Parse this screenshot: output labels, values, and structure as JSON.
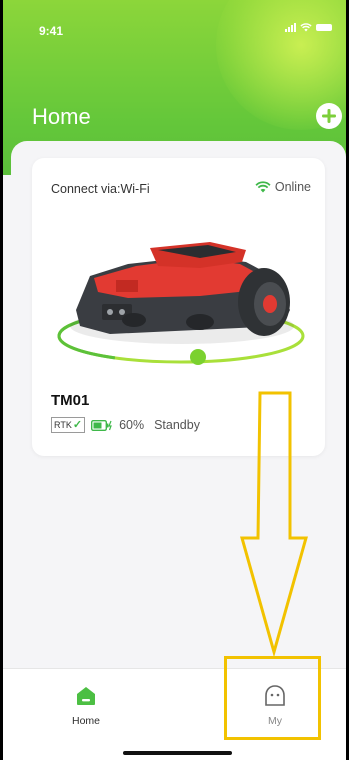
{
  "status_bar": {
    "time": "9:41"
  },
  "header": {
    "title": "Home"
  },
  "device_card": {
    "connection_label": "Connect via:Wi-Fi",
    "connection_status": "Online",
    "device_name": "TM01",
    "rtk_label": "RTK",
    "battery_percent": "60%",
    "state": "Standby"
  },
  "tabbar": {
    "tabs": [
      {
        "label": "Home",
        "icon": "home-icon",
        "active": true
      },
      {
        "label": "My",
        "icon": "profile-icon",
        "active": false
      }
    ]
  },
  "colors": {
    "brand_green": "#5bbf3b",
    "online_green": "#3fb84a",
    "highlight_yellow": "#f2c200",
    "mower_red": "#e23a32"
  }
}
